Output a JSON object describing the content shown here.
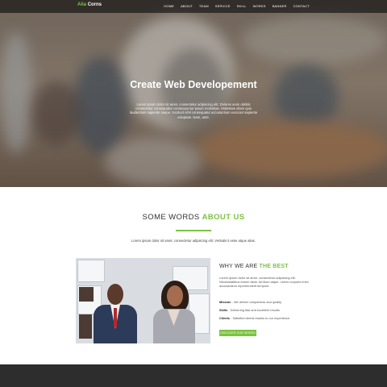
{
  "brand": {
    "name": "Alia",
    "accent": "Corns"
  },
  "nav": [
    "HOME",
    "ABOUT",
    "TEAM",
    "SERVICE",
    "SKILL",
    "WORKS",
    "BANNER",
    "CONTACT"
  ],
  "hero": {
    "title": "Create Web Developement",
    "description": "Lorem ipsum dolor sit amet, consectetur adipiscing elit. Dolores anim debitis consectetur consequatur consequuntur ipsum molestiae. Molestias ullam quis laudantium sapiente saepe. Incidunt nihil consequatur accusantium excicant sapiente voluptate. Nam, ante."
  },
  "about": {
    "title_plain": "SOME WORDS ",
    "title_highlight": "ABOUT US",
    "subtitle": "Lorem ipsum dolor sit amet, consectetur adipiscing elit. Veritatis it esse atque alias."
  },
  "why": {
    "title_plain": "WHY WE ARE ",
    "title_highlight": "THE BEST",
    "description": "Lorem ipsum dolor sit amet, consectetur adipiscing elit. Necessitatibus earum dicta. Ad illum atque. Libero corporis enim accusantium reprehenderit tempore.",
    "items": [
      {
        "label": "Mission",
        "text": " - We deliver uniqueness and quality"
      },
      {
        "label": "Skills",
        "text": " - Delivering fast and excellent results"
      },
      {
        "label": "Clients",
        "text": " - Satisfied clients thanks to our experience"
      }
    ],
    "cta": "DISCOVER OUR WORKS"
  },
  "colors": {
    "accent": "#7cc242",
    "footer": "#2d2d2d"
  }
}
